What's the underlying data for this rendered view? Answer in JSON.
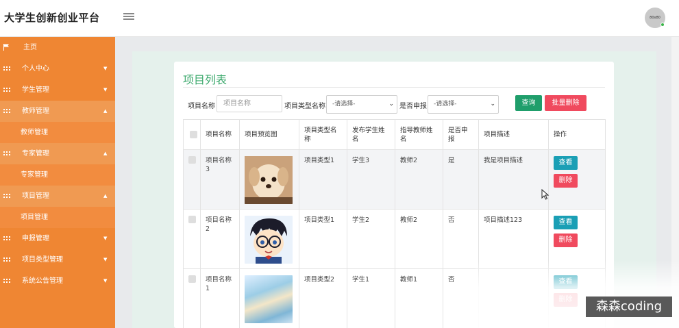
{
  "app": {
    "title": "大学生创新创业平台",
    "avatar_text": "80x80"
  },
  "sidebar": {
    "home_label": "主页",
    "items": [
      {
        "label": "个人中心",
        "open": false
      },
      {
        "label": "学生管理",
        "open": false
      },
      {
        "label": "教师管理",
        "open": true,
        "sub": "教师管理"
      },
      {
        "label": "专家管理",
        "open": true,
        "sub": "专家管理"
      },
      {
        "label": "项目管理",
        "open": true,
        "sub": "项目管理"
      },
      {
        "label": "申报管理",
        "open": false
      },
      {
        "label": "项目类型管理",
        "open": false
      },
      {
        "label": "系统公告管理",
        "open": false
      }
    ]
  },
  "page": {
    "title": "项目列表"
  },
  "filters": {
    "name_label": "项目名称",
    "name_placeholder": "项目名称",
    "type_label": "项目类型名称",
    "type_selected": "-请选择-",
    "declare_label": "是否申报",
    "declare_selected": "-请选择-",
    "query_button": "查询",
    "batch_delete_button": "批量删除"
  },
  "table": {
    "headers": [
      "项目名称",
      "项目预览图",
      "项目类型名称",
      "发布学生姓名",
      "指导教师姓名",
      "是否申报",
      "项目描述",
      "操作"
    ],
    "rows": [
      {
        "name": "项目名称3",
        "image": "puppy",
        "type": "项目类型1",
        "student": "学生3",
        "teacher": "教师2",
        "declared": "是",
        "desc": "我是项目描述"
      },
      {
        "name": "项目名称2",
        "image": "cartoon-boy",
        "type": "项目类型1",
        "student": "学生2",
        "teacher": "教师2",
        "declared": "否",
        "desc": "项目描述123"
      },
      {
        "name": "项目名称1",
        "image": "blurred-beach",
        "type": "项目类型2",
        "student": "学生1",
        "teacher": "教师1",
        "declared": "否",
        "desc": ""
      }
    ],
    "view_button": "查看",
    "delete_button": "删除"
  },
  "watermark": "森森coding",
  "colors": {
    "sidebar": "#ef8633",
    "title_green": "#3aa86b",
    "query_green": "#1f9e6b",
    "delete_red": "#f04a5e",
    "view_teal": "#1a9fb5"
  }
}
